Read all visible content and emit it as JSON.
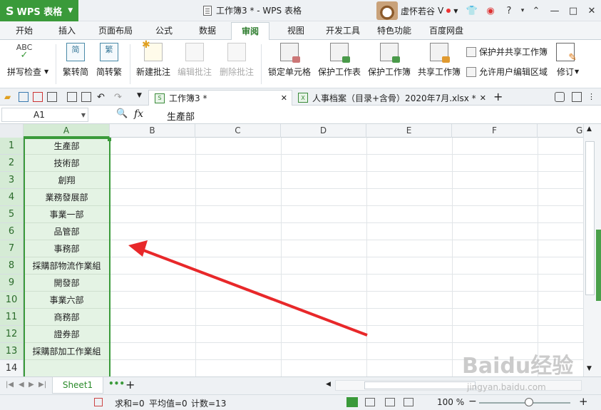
{
  "app": {
    "logo": "WPS 表格",
    "doc_title": "工作簿3 * - WPS 表格",
    "user_name": "虚怀若谷"
  },
  "menu_tabs": [
    "开始",
    "插入",
    "页面布局",
    "公式",
    "数据",
    "审阅",
    "视图",
    "开发工具",
    "特色功能",
    "百度网盘"
  ],
  "active_menu": "审阅",
  "ribbon": {
    "spell_check": "拼写检查",
    "trad_to_simp": "繁转简",
    "simp_to_trad": "简转繁",
    "new_comment": "新建批注",
    "edit_comment": "编辑批注",
    "delete_comment": "删除批注",
    "lock_cell": "锁定单元格",
    "protect_sheet": "保护工作表",
    "protect_book": "保护工作簿",
    "share_book": "共享工作簿",
    "protect_share": "保护并共享工作簿",
    "allow_edit_ranges": "允许用户编辑区域",
    "revise": "修订"
  },
  "doc_tabs": [
    {
      "label": "工作簿3 *",
      "active": true
    },
    {
      "label": "人事档案（目录+含骨）2020年7月.xlsx *",
      "active": false
    }
  ],
  "formula_bar": {
    "name_box": "A1",
    "fx": "fx",
    "value": "生產部"
  },
  "columns": [
    "A",
    "B",
    "C",
    "D",
    "E",
    "F",
    "G"
  ],
  "rows": [
    "1",
    "2",
    "3",
    "4",
    "5",
    "6",
    "7",
    "8",
    "9",
    "10",
    "11",
    "12",
    "13",
    "14"
  ],
  "column_a_values": [
    "生產部",
    "技術部",
    "創翔",
    "業務發展部",
    "事業一部",
    "品管部",
    "事務部",
    "採購部物流作業組",
    "開發部",
    "事業六部",
    "商務部",
    "證券部",
    "採購部加工作業組",
    ""
  ],
  "sheet_tab": "Sheet1",
  "status": {
    "sum": "求和=0",
    "average": "平均值=0",
    "count": "计数=13",
    "zoom": "100 %"
  },
  "watermark": {
    "logo": "Baidu经验",
    "url": "jingyan.baidu.com"
  },
  "colors": {
    "accent": "#3a9a3a",
    "arrow": "#e8282a",
    "selection_fill": "#e4f3e4"
  }
}
